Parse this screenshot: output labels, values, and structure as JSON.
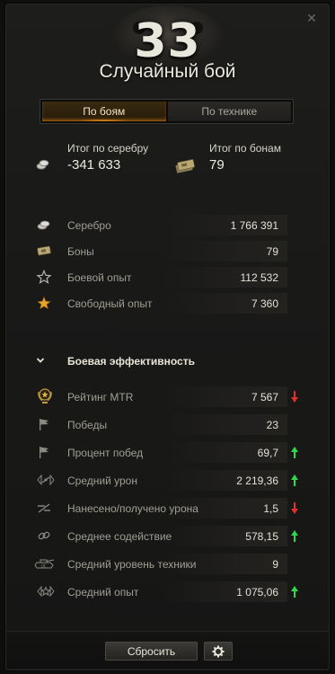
{
  "header": {
    "battle_count": "33",
    "battle_type": "Случайный бой"
  },
  "tabs": [
    {
      "label": "По боям",
      "active": true
    },
    {
      "label": "По технике",
      "active": false
    }
  ],
  "totals": {
    "silver": {
      "label": "Итог по серебру",
      "value": "-341 633",
      "icon": "silver-coins-icon"
    },
    "bonds": {
      "label": "Итог по бонам",
      "value": "79",
      "icon": "bonds-stack-icon"
    }
  },
  "income": [
    {
      "label": "Серебро",
      "value": "1 766 391",
      "icon": "silver-icon"
    },
    {
      "label": "Боны",
      "value": "79",
      "icon": "bonds-icon"
    },
    {
      "label": "Боевой опыт",
      "value": "112 532",
      "icon": "star-outline-icon"
    },
    {
      "label": "Свободный опыт",
      "value": "7 360",
      "icon": "star-gold-icon"
    }
  ],
  "efficiency": {
    "title": "Боевая эффективность",
    "rows": [
      {
        "label": "Рейтинг MTR",
        "value": "7 567",
        "icon": "mtr-rating-icon",
        "trend": "down"
      },
      {
        "label": "Победы",
        "value": "23",
        "icon": "flag-icon",
        "trend": "none"
      },
      {
        "label": "Процент побед",
        "value": "69,7",
        "icon": "flag-icon",
        "trend": "up"
      },
      {
        "label": "Средний урон",
        "value": "2 219,36",
        "icon": "damage-icon",
        "trend": "up"
      },
      {
        "label": "Нанесено/получено урона",
        "value": "1,5",
        "icon": "ratio-icon",
        "trend": "down"
      },
      {
        "label": "Среднее содействие",
        "value": "578,15",
        "icon": "assist-icon",
        "trend": "up"
      },
      {
        "label": "Средний уровень техники",
        "value": "9",
        "icon": "tank-tier-icon",
        "trend": "none"
      },
      {
        "label": "Средний опыт",
        "value": "1 075,06",
        "icon": "avg-xp-icon",
        "trend": "up"
      }
    ]
  },
  "footer": {
    "reset_label": "Сбросить",
    "settings_icon": "gear-icon"
  },
  "colors": {
    "accent_orange": "#d27a12",
    "trend_up": "#2fd94a",
    "trend_down": "#e0302a"
  }
}
